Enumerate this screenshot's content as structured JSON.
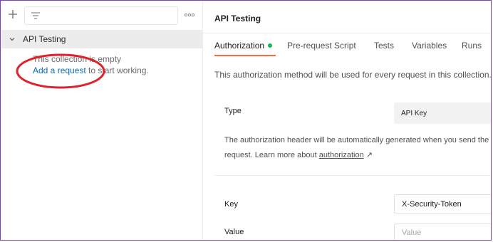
{
  "sidebar": {
    "collection_name": "API Testing",
    "empty_text": "This collection is empty",
    "add_request_link": "Add a request",
    "add_request_suffix": " to start working.",
    "icons": [
      "plus-icon",
      "filter-icon",
      "more-icon",
      "chevron-down-icon"
    ]
  },
  "header": {
    "title": "API Testing"
  },
  "tabs": [
    {
      "label": "Authorization",
      "active": true,
      "indicator": "green-dot"
    },
    {
      "label": "Pre-request Script"
    },
    {
      "label": "Tests"
    },
    {
      "label": "Variables"
    },
    {
      "label": "Runs"
    }
  ],
  "auth": {
    "description": "This authorization method will be used for every request in this collection.",
    "type_label": "Type",
    "type_value": "API Key",
    "help_line1": "The authorization header will be automatically generated when you send the",
    "help_line2_prefix": "request. Learn more about ",
    "help_link": "authorization",
    "help_link_arrow": " ↗",
    "key_label": "Key",
    "key_value": "X-Security-Token",
    "value_label": "Value",
    "value_placeholder": "Value"
  },
  "colors": {
    "accent_tab": "#ff6c37",
    "status_dot": "#0cbb52",
    "link": "#0d6bb8",
    "annotation": "#e0202a",
    "frame_border": "#7b3fc4"
  }
}
